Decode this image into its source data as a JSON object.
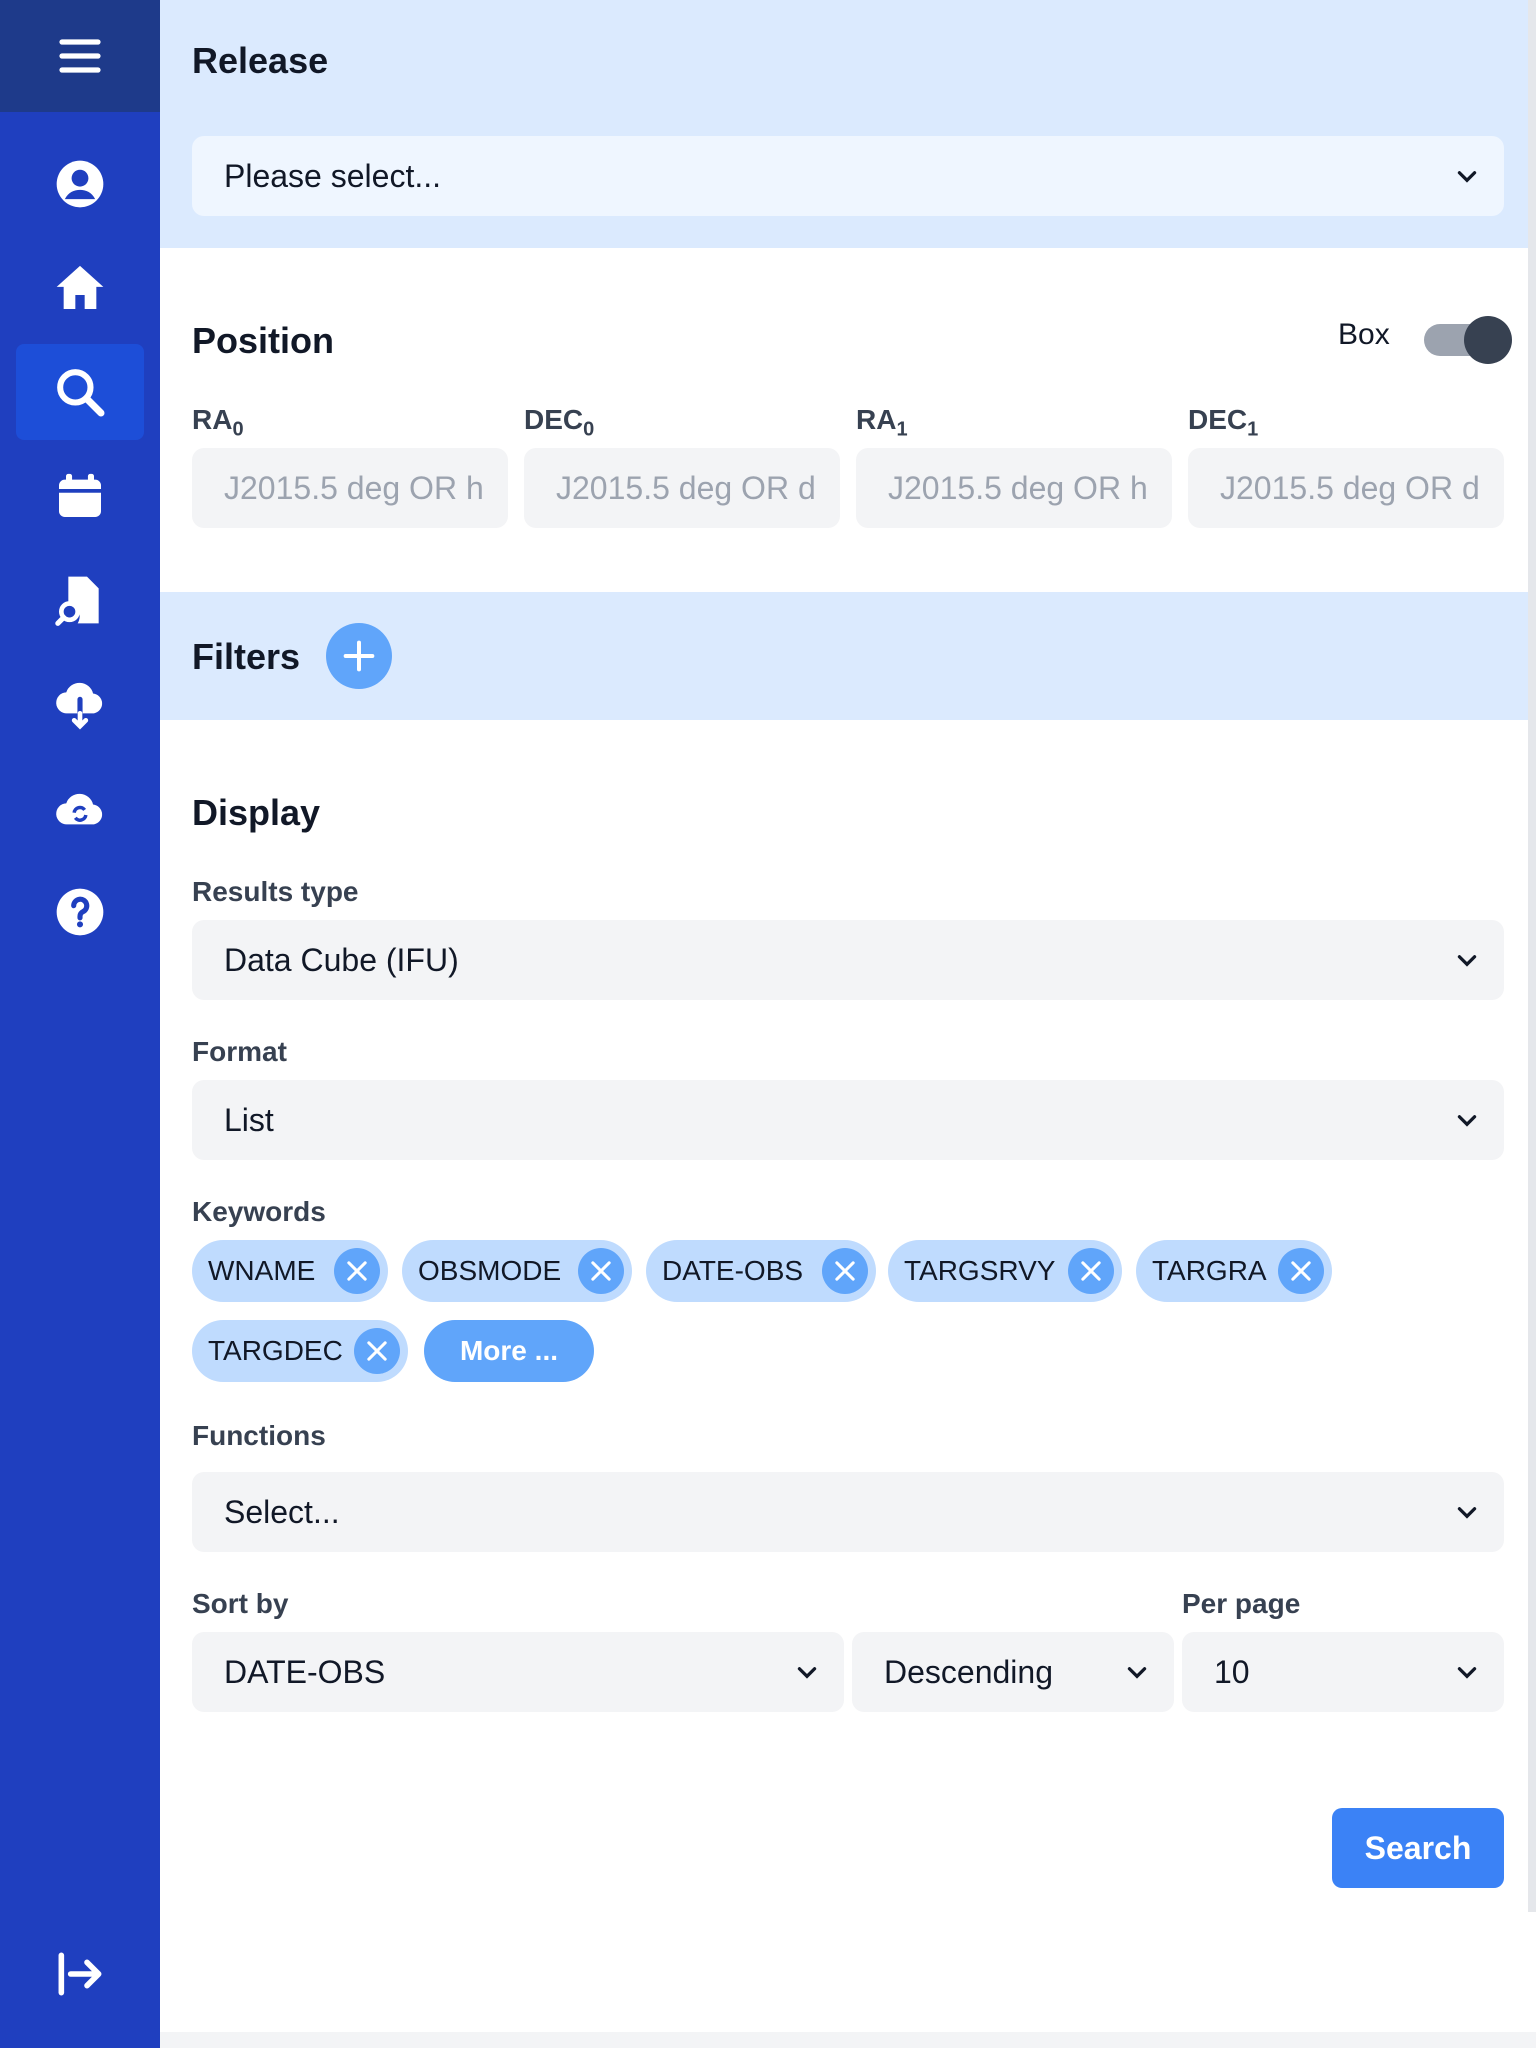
{
  "colors": {
    "sidebar": "#1f3fbf",
    "sidebar_top": "#1e3a8a",
    "active": "#1d4ed8",
    "band": "#dbeafe",
    "chip": "#bfdbfe",
    "chip_close": "#60a5fa",
    "primary_button": "#3b82f6"
  },
  "sidebar": {
    "items": [
      {
        "name": "menu-icon"
      },
      {
        "name": "user-icon"
      },
      {
        "name": "home-icon"
      },
      {
        "name": "search-icon",
        "active": true
      },
      {
        "name": "calendar-icon"
      },
      {
        "name": "file-search-icon"
      },
      {
        "name": "cloud-download-icon"
      },
      {
        "name": "cloud-sync-icon"
      },
      {
        "name": "help-icon"
      },
      {
        "name": "logout-icon"
      }
    ]
  },
  "release": {
    "title": "Release",
    "select_value": "Please select..."
  },
  "position": {
    "title": "Position",
    "toggle_label": "Box",
    "fields": [
      {
        "label": "RA",
        "sub": "0",
        "placeholder": "J2015.5 deg OR h"
      },
      {
        "label": "DEC",
        "sub": "0",
        "placeholder": "J2015.5 deg OR d"
      },
      {
        "label": "RA",
        "sub": "1",
        "placeholder": "J2015.5 deg OR h"
      },
      {
        "label": "DEC",
        "sub": "1",
        "placeholder": "J2015.5 deg OR d"
      }
    ]
  },
  "filters": {
    "title": "Filters"
  },
  "display": {
    "title": "Display",
    "results_type_label": "Results type",
    "results_type_value": "Data Cube (IFU)",
    "format_label": "Format",
    "format_value": "List",
    "keywords_label": "Keywords",
    "keywords": [
      "WNAME",
      "OBSMODE",
      "DATE-OBS",
      "TARGSRVY",
      "TARGRA",
      "TARGDEC"
    ],
    "more_label": "More ...",
    "functions_label": "Functions",
    "functions_value": "Select...",
    "sort_by_label": "Sort by",
    "sort_by_value": "DATE-OBS",
    "sort_order_value": "Descending",
    "per_page_label": "Per page",
    "per_page_value": "10"
  },
  "actions": {
    "search_label": "Search"
  }
}
